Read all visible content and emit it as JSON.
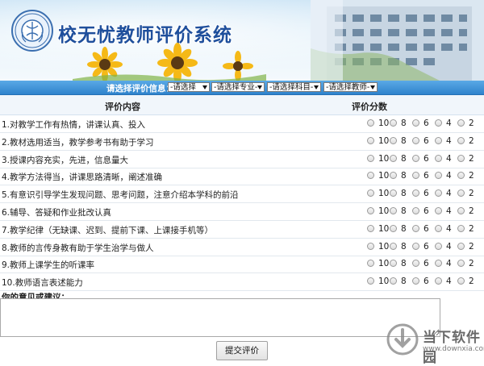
{
  "header": {
    "title": "校无忧教师评价系统",
    "logo_icon": "university-emblem-icon"
  },
  "filters": {
    "label": "请选择评价信息：",
    "selects": [
      {
        "name": "filter-select-1",
        "value": "-请选择"
      },
      {
        "name": "filter-select-major",
        "value": "-请选择专业-"
      },
      {
        "name": "filter-select-subject",
        "value": "-请选择科目-"
      },
      {
        "name": "filter-select-teacher",
        "value": "-请选择教师-"
      }
    ]
  },
  "table": {
    "col_content": "评价内容",
    "col_score": "评价分数",
    "score_options": [
      "10",
      "8",
      "6",
      "4",
      "2"
    ],
    "rows": [
      {
        "text": "1.对教学工作有热情，讲课认真、投入"
      },
      {
        "text": "2.教材选用适当，教学参考书有助于学习"
      },
      {
        "text": "3.授课内容充实，先进，信息量大"
      },
      {
        "text": "4.教学方法得当，讲课思路清晰，阐述准确"
      },
      {
        "text": "5.有意识引导学生发现问题、思考问题，注意介绍本学科的前沿"
      },
      {
        "text": "6.辅导、答疑和作业批改认真"
      },
      {
        "text": "7.教学纪律（无缺课、迟到、提前下课、上课接手机等）"
      },
      {
        "text": "8.教师的言传身教有助于学生治学与做人"
      },
      {
        "text": "9.教师上课学生的听课率"
      },
      {
        "text": "10.教师语言表述能力"
      }
    ]
  },
  "comments": {
    "label": "你的意见或建议：",
    "value": ""
  },
  "submit_label": "提交评价",
  "watermark": {
    "text": "当下软件园",
    "url": "www.downxia.com"
  },
  "colors": {
    "title": "#1f4f9c",
    "filter_bar": "#2f83cc",
    "header_bg": "#f1f6fb"
  }
}
